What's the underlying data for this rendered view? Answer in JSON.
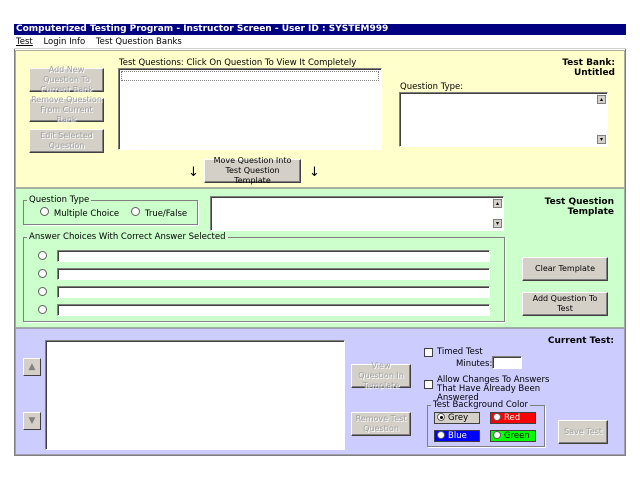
{
  "window": {
    "title": "Computerized Testing Program - Instructor Screen - User ID : SYSTEM999"
  },
  "menu": [
    "Test",
    "Login Info",
    "Test Question Banks"
  ],
  "bank_panel": {
    "add_button": "Add New Question To Current Bank",
    "remove_button": "Remove Question From Current Bank",
    "edit_button": "Edit Selected Question",
    "questions_label": "Test Questions: Click On Question To View It Completely",
    "bank_title": "Test Bank: Untitled",
    "question_type_label": "Question Type:",
    "move_button": "Move Question Into Test Question Template",
    "arrow_glyph": "↓"
  },
  "template_panel": {
    "title": "Test Question Template",
    "question_type_group": "Question Type",
    "type_options": [
      "Multiple Choice",
      "True/False"
    ],
    "answers_group": "Answer Choices With Correct Answer Selected",
    "answer_rows": 4,
    "clear_button": "Clear Template",
    "add_button": "Add Question To Test"
  },
  "current_panel": {
    "title": "Current Test:",
    "up_arrow": "▲",
    "down_arrow": "▼",
    "view_button": "View Question In Template",
    "remove_button": "Remove Test Question",
    "timed_test_label": "Timed Test",
    "minutes_label": "Minutes:",
    "minutes_value": "",
    "allow_changes_label": "Allow Changes To Answers That Have Already Been Answered",
    "bg_color_group": "Test Background Color",
    "colors": [
      {
        "label": "Grey",
        "color": "#d4d0c8",
        "text_color": "#000000",
        "selected": true
      },
      {
        "label": "Red",
        "color": "#ff0000",
        "text_color": "#ffffff",
        "selected": false
      },
      {
        "label": "Blue",
        "color": "#0000ff",
        "text_color": "#ffffff",
        "selected": false
      },
      {
        "label": "Green",
        "color": "#00ff00",
        "text_color": "#000000",
        "selected": false
      }
    ],
    "save_button": "Save Test"
  },
  "colors": {
    "titlebar": "#000080",
    "bank_panel": "#ffffcc",
    "template_panel": "#ccffcc",
    "current_panel": "#ccccff"
  }
}
